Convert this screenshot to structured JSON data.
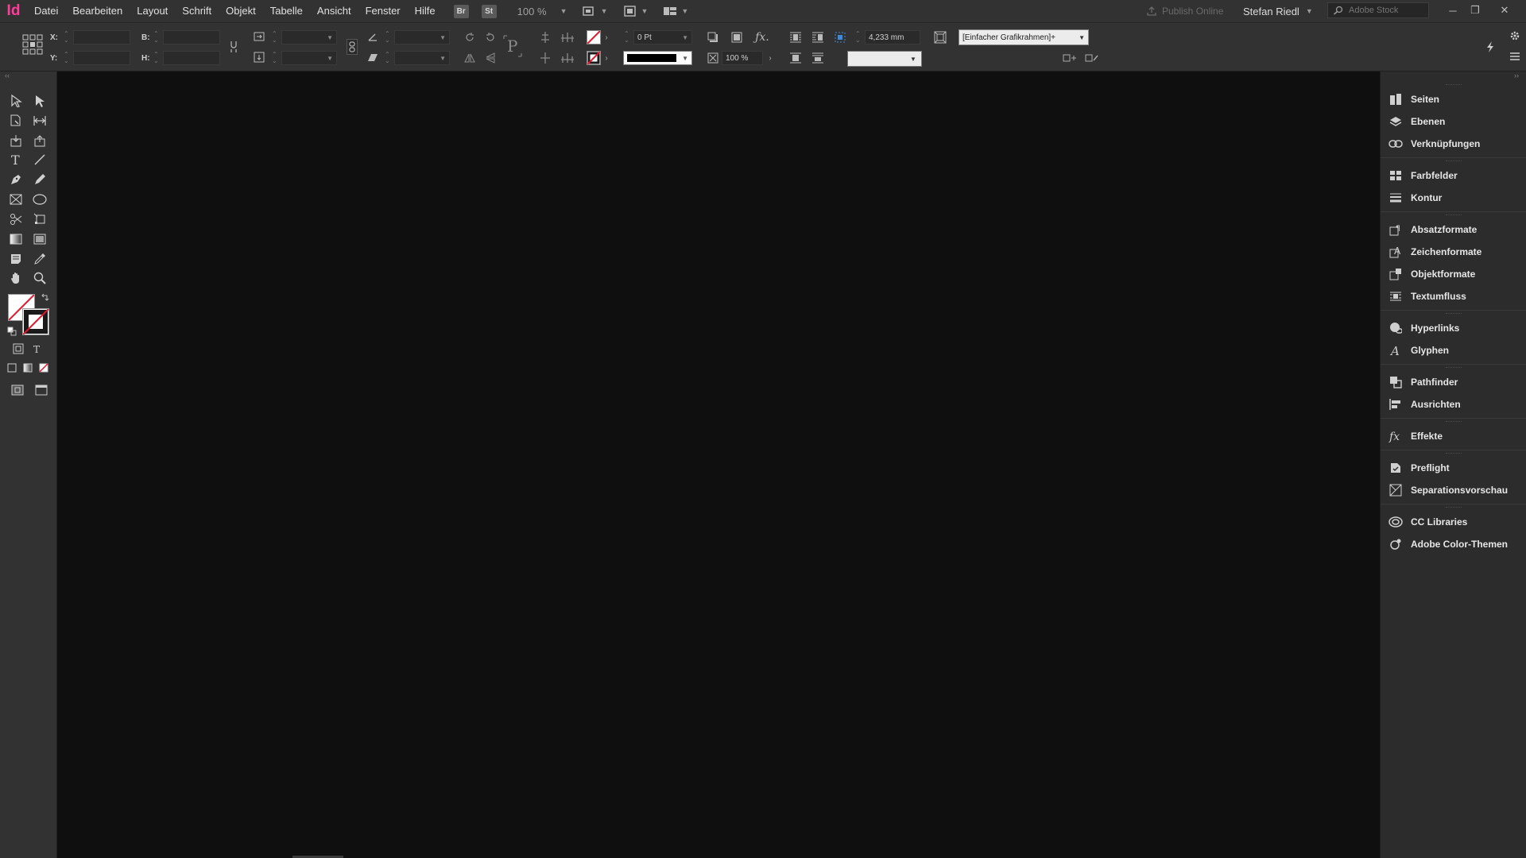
{
  "app": {
    "logo": "Id"
  },
  "menu": [
    "Datei",
    "Bearbeiten",
    "Layout",
    "Schrift",
    "Objekt",
    "Tabelle",
    "Ansicht",
    "Fenster",
    "Hilfe"
  ],
  "badges": {
    "bridge": "Br",
    "stock": "St"
  },
  "zoom": "100 %",
  "publish_online": "Publish Online",
  "user_name": "Stefan Riedl",
  "stock_search": {
    "placeholder": "Adobe Stock"
  },
  "control": {
    "x_label": "X:",
    "y_label": "Y:",
    "w_label": "B:",
    "h_label": "H:",
    "stroke_weight": "0 Pt",
    "opacity": "100 %",
    "offset": "4,233 mm",
    "object_style": "[Einfacher Grafikrahmen]+"
  },
  "panels": [
    {
      "label": "Seiten",
      "icon": "pages-icon"
    },
    {
      "label": "Ebenen",
      "icon": "layers-icon"
    },
    {
      "label": "Verknüpfungen",
      "icon": "links-icon"
    },
    {
      "label": "Farbfelder",
      "icon": "swatches-icon"
    },
    {
      "label": "Kontur",
      "icon": "stroke-icon"
    },
    {
      "label": "Absatzformate",
      "icon": "paragraph-styles-icon"
    },
    {
      "label": "Zeichenformate",
      "icon": "character-styles-icon"
    },
    {
      "label": "Objektformate",
      "icon": "object-styles-icon"
    },
    {
      "label": "Textumfluss",
      "icon": "text-wrap-icon"
    },
    {
      "label": "Hyperlinks",
      "icon": "hyperlinks-icon"
    },
    {
      "label": "Glyphen",
      "icon": "glyphs-icon"
    },
    {
      "label": "Pathfinder",
      "icon": "pathfinder-icon"
    },
    {
      "label": "Ausrichten",
      "icon": "align-icon"
    },
    {
      "label": "Effekte",
      "icon": "effects-icon"
    },
    {
      "label": "Preflight",
      "icon": "preflight-icon"
    },
    {
      "label": "Separationsvorschau",
      "icon": "separations-icon"
    },
    {
      "label": "CC Libraries",
      "icon": "cc-libraries-icon"
    },
    {
      "label": "Adobe Color-Themen",
      "icon": "adobe-color-icon"
    }
  ],
  "colors": {
    "accent": "#ff3c9c",
    "canvas": "#0f0f0f",
    "chrome": "#323232",
    "none_swatch": "#e8142a"
  }
}
